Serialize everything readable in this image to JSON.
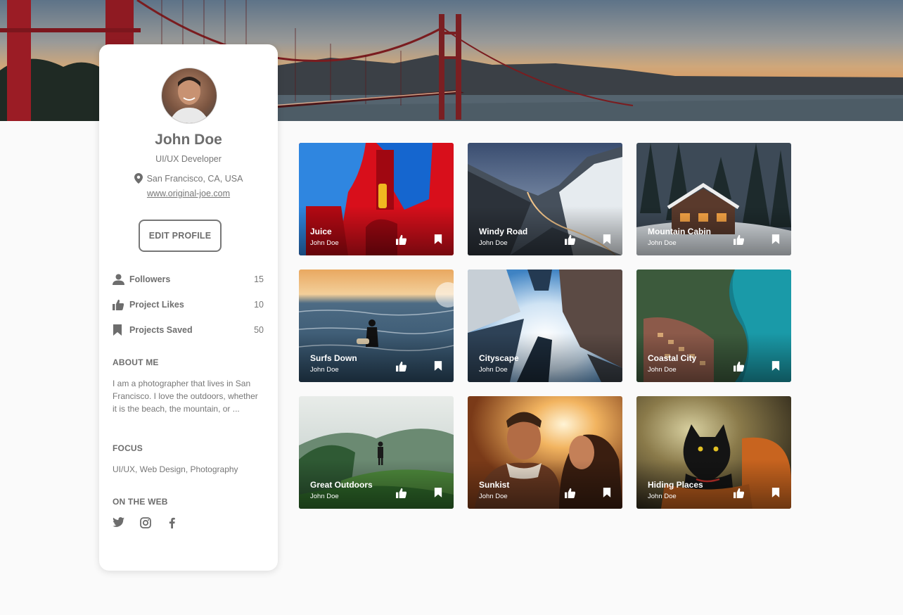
{
  "profile": {
    "name": "John Doe",
    "role": "UI/UX Developer",
    "location": "San Francisco, CA, USA",
    "website": "www.original-joe.com",
    "edit_button": "EDIT PROFILE"
  },
  "stats": [
    {
      "label": "Followers",
      "value": "15",
      "icon": "person-icon"
    },
    {
      "label": "Project Likes",
      "value": "10",
      "icon": "thumbs-up-icon"
    },
    {
      "label": "Projects Saved",
      "value": "50",
      "icon": "bookmark-icon"
    }
  ],
  "about": {
    "heading": "ABOUT ME",
    "text": "I am a photographer that lives in San Francisco. I love the outdoors, whether it is the beach, the mountain, or ..."
  },
  "focus": {
    "heading": "FOCUS",
    "text": "UI/UX, Web Design, Photography"
  },
  "web": {
    "heading": "ON THE WEB",
    "icons": [
      "twitter-icon",
      "instagram-icon",
      "facebook-icon"
    ]
  },
  "projects": [
    {
      "title": "Juice",
      "author": "John Doe"
    },
    {
      "title": "Windy Road",
      "author": "John Doe"
    },
    {
      "title": "Mountain Cabin",
      "author": "John Doe"
    },
    {
      "title": "Surfs Down",
      "author": "John Doe"
    },
    {
      "title": "Cityscape",
      "author": "John Doe"
    },
    {
      "title": "Coastal City",
      "author": "John Doe"
    },
    {
      "title": "Great Outdoors",
      "author": "John Doe"
    },
    {
      "title": "Sunkist",
      "author": "John Doe"
    },
    {
      "title": "Hiding Places",
      "author": "John Doe"
    }
  ],
  "colors": {
    "card_bg": "#ffffff",
    "page_bg": "#fafafa",
    "text": "#6d6d6d"
  }
}
